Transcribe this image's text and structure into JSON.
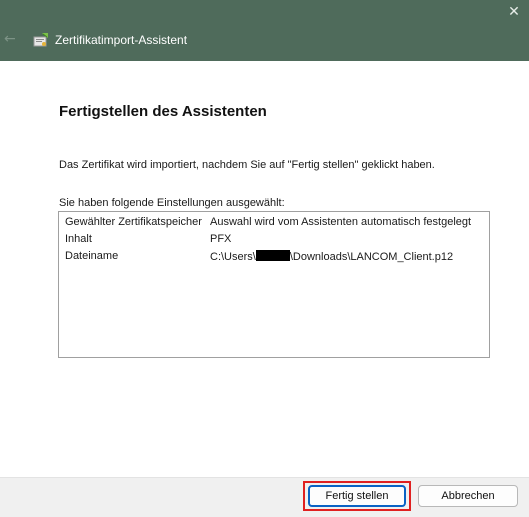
{
  "window": {
    "title": "Zertifikatimport-Assistent",
    "close_glyph": "✕",
    "back_glyph": "←"
  },
  "content": {
    "heading": "Fertigstellen des Assistenten",
    "description": "Das Zertifikat wird importiert, nachdem Sie auf \"Fertig stellen\" geklickt haben.",
    "settings_label": "Sie haben folgende Einstellungen ausgewählt:",
    "settings": [
      {
        "key": "Gewählter Zertifikatspeicher",
        "value": "Auswahl wird vom Assistenten automatisch festgelegt"
      },
      {
        "key": "Inhalt",
        "value": "PFX"
      },
      {
        "key": "Dateiname",
        "value_prefix": "C:\\Users\\",
        "value_suffix": "\\Downloads\\LANCOM_Client.p12"
      }
    ]
  },
  "footer": {
    "finish_label": "Fertig stellen",
    "cancel_label": "Abbrechen"
  },
  "colors": {
    "titlebar": "#4f6b5b",
    "primary_border": "#0a62c4",
    "highlight": "#e02020"
  },
  "icons": {
    "title_icon": "certificate-wizard-icon",
    "back": "back-arrow-icon",
    "close": "close-icon"
  }
}
